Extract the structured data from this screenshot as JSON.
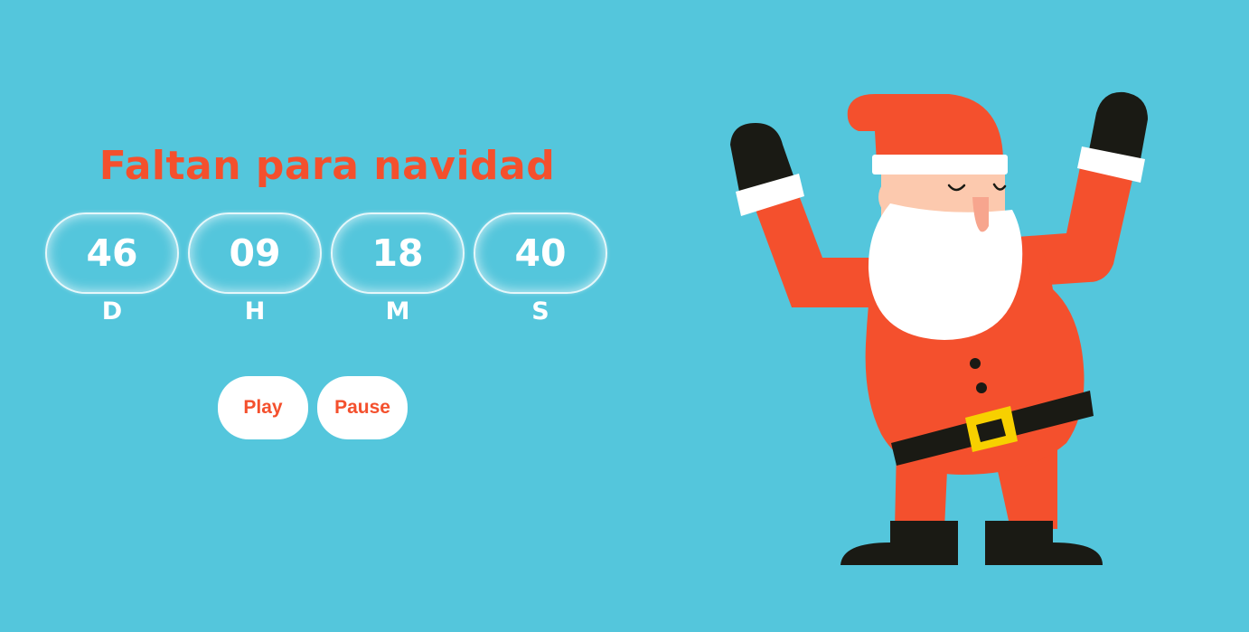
{
  "countdown": {
    "title": "Faltan para navidad",
    "units": [
      {
        "value": "46",
        "label": "D"
      },
      {
        "value": "09",
        "label": "H"
      },
      {
        "value": "18",
        "label": "M"
      },
      {
        "value": "40",
        "label": "S"
      }
    ]
  },
  "controls": {
    "play_label": "Play",
    "pause_label": "Pause"
  },
  "illustration": {
    "name": "dancing-santa-illustration",
    "colors": {
      "background": "#54c6dc",
      "suit": "#f4502d",
      "black": "#1a1a14",
      "white": "#ffffff",
      "skin": "#fcc9ae",
      "buckle": "#f7d000"
    }
  }
}
